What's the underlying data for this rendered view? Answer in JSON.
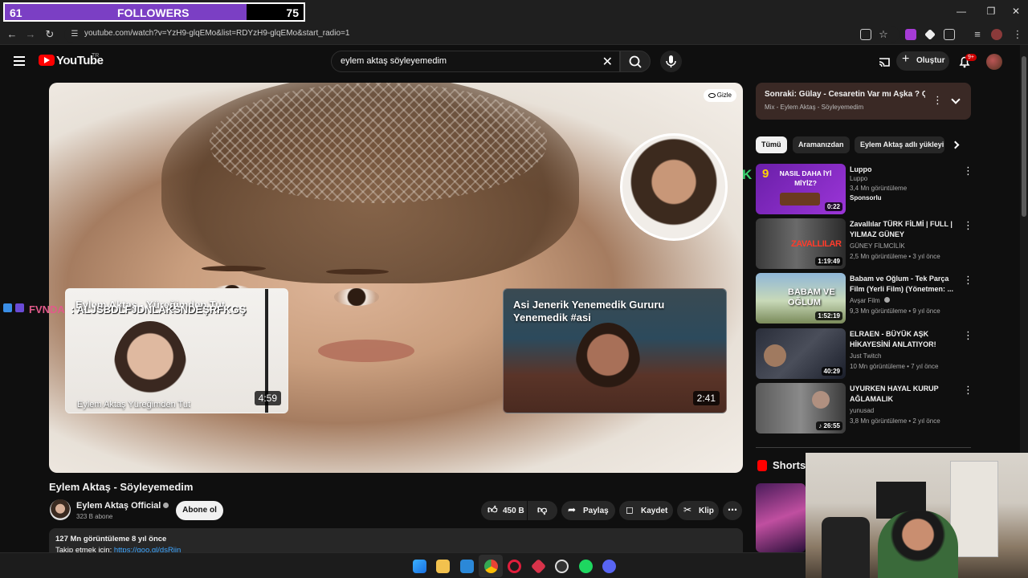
{
  "followers_goal": {
    "current": "61",
    "label": "FOLLOWERS",
    "target": "75",
    "progress": 0.81,
    "fill_color": "#7b3fc4"
  },
  "browser": {
    "url": "youtube.com/watch?v=YzH9-glqEMo&list=RDYzH9-glqEMo&start_radio=1",
    "window_controls": [
      "minimize-icon",
      "restore-icon",
      "close-icon"
    ]
  },
  "header": {
    "logo_text": "YouTube",
    "region": "TR",
    "search_value": "eylem aktaş söyleyemedim",
    "create_label": "Oluştur",
    "notification_badge": "9+"
  },
  "player": {
    "hide_label": "Gizle",
    "end_cards": [
      {
        "title": "Eylem Aktaş - Yüreğimden Tut",
        "subtitle": "Eylem Aktaş Yüreğimden Tut",
        "duration": "4:59"
      },
      {
        "title": "Asi Jenerik Yenemedik Gururu Yenemedik #asi",
        "duration": "2:41"
      }
    ]
  },
  "chat_overlay": {
    "username": "FVNDA",
    "message": ": ALJSBDLFJDNLAKSNDEŞRFKGŞ"
  },
  "video": {
    "title": "Eylem Aktaş - Söyleyemedim",
    "channel": "Eylem Aktaş Official",
    "subscribers": "323 B abone",
    "subscribe_label": "Abone ol",
    "likes": "450 B",
    "share_label": "Paylaş",
    "save_label": "Kaydet",
    "clip_label": "Klip",
    "views_date": "127 Mn görüntüleme  8 yıl önce",
    "desc_prefix": "Takip etmek için: ",
    "desc_link": "https://goo.gl/dsRiin"
  },
  "up_next": {
    "title": "Sonraki: Gülay - Cesaretin Var mı Aşka ? Çar...",
    "subtitle": "Mix - Eylem Aktaş - Söyleyemedim"
  },
  "chips": [
    "Tümü",
    "Aramanızdan",
    "Eylem Aktaş adlı yükleyi"
  ],
  "recommendations": [
    {
      "title": "Luppo",
      "channel": "Luppo",
      "meta": "3,4 Mn görüntüleme",
      "badge": "Sponsorlu",
      "duration": "0:22",
      "thumb_text": "NASIL DAHA İYİ MİYİZ?"
    },
    {
      "title": "Zavallılar TÜRK FİLMİ | FULL | YILMAZ GÜNEY",
      "channel": "GÜNEY FİLMCİLİK",
      "meta": "2,5 Mn görüntüleme • 3 yıl önce",
      "duration": "1:19:49",
      "thumb_text": "ZAVALLILAR"
    },
    {
      "title": "Babam ve Oğlum - Tek Parça Film (Yerli Film) (Yönetmen: ...",
      "channel": "Avşar Film",
      "meta": "9,3 Mn görüntüleme • 9 yıl önce",
      "duration": "1:52:19",
      "thumb_text": "BABAM VE OĞLUM"
    },
    {
      "title": "ELRAEN - BÜYÜK AŞK HİKAYESİNİ ANLATIYOR!",
      "channel": "Just Twitch",
      "meta": "10 Mn görüntüleme • 7 yıl önce",
      "duration": "40:29"
    },
    {
      "title": "UYURKEN HAYAL KURUP AĞLAMALIK",
      "channel": "yunusad",
      "meta": "3,8 Mn görüntüleme • 2 yıl önce",
      "duration": "26:55"
    }
  ],
  "shorts_label": "Shorts",
  "taskbar_apps": [
    "windows-start-icon",
    "file-explorer-icon",
    "mail-icon",
    "chrome-icon",
    "opera-gx-icon",
    "app-red-icon",
    "obs-icon",
    "spotify-icon",
    "discord-icon"
  ],
  "colors": {
    "background": "#0f0f0f",
    "accent_red": "#ff0000",
    "link_blue": "#3ea6ff",
    "chat_name": "#e05a8a"
  }
}
